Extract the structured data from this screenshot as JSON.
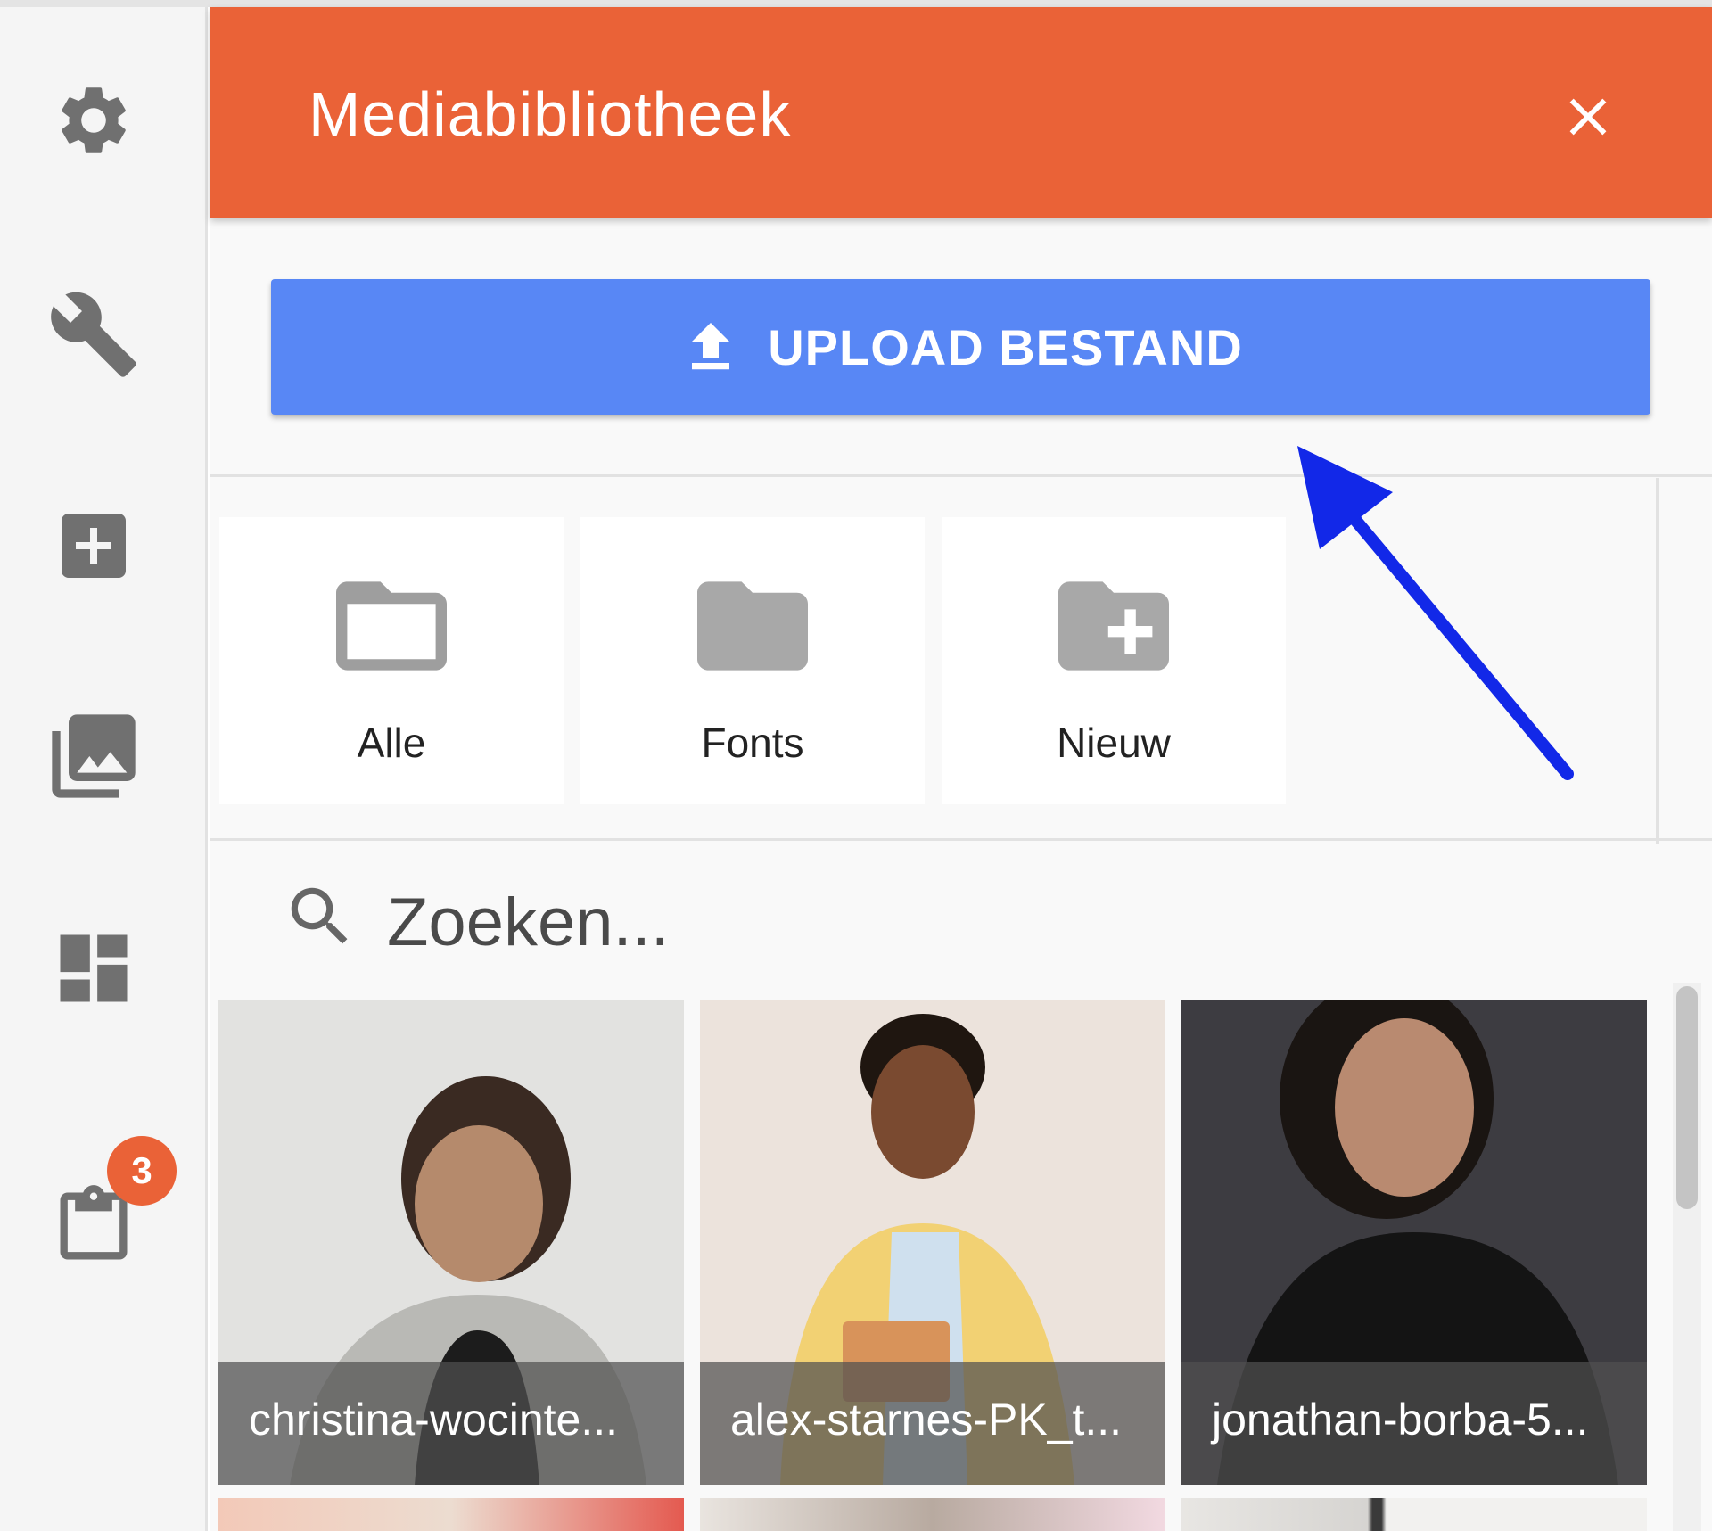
{
  "sidebar": {
    "icons": [
      "gear-icon",
      "wrench-icon",
      "add-box-icon",
      "photo-library-icon",
      "dashboard-icon",
      "clipboard-icon"
    ],
    "badge_count": "3"
  },
  "header": {
    "title": "Mediabibliotheek",
    "close_icon": "close-icon"
  },
  "upload": {
    "label": "UPLOAD BESTAND",
    "icon": "upload-icon"
  },
  "folders": [
    {
      "label": "Alle",
      "icon": "folder-outline-icon"
    },
    {
      "label": "Fonts",
      "icon": "folder-icon"
    },
    {
      "label": "Nieuw",
      "icon": "new-folder-icon"
    }
  ],
  "search": {
    "placeholder": "Zoeken...",
    "icon": "search-icon"
  },
  "images": [
    {
      "caption": "christina-wocinte..."
    },
    {
      "caption": "alex-starnes-PK_t..."
    },
    {
      "caption": "jonathan-borba-5..."
    }
  ],
  "colors": {
    "header": "#ea6237",
    "upload_button": "#5887f5",
    "badge": "#ea6237",
    "annotation_arrow": "#1228e8"
  }
}
